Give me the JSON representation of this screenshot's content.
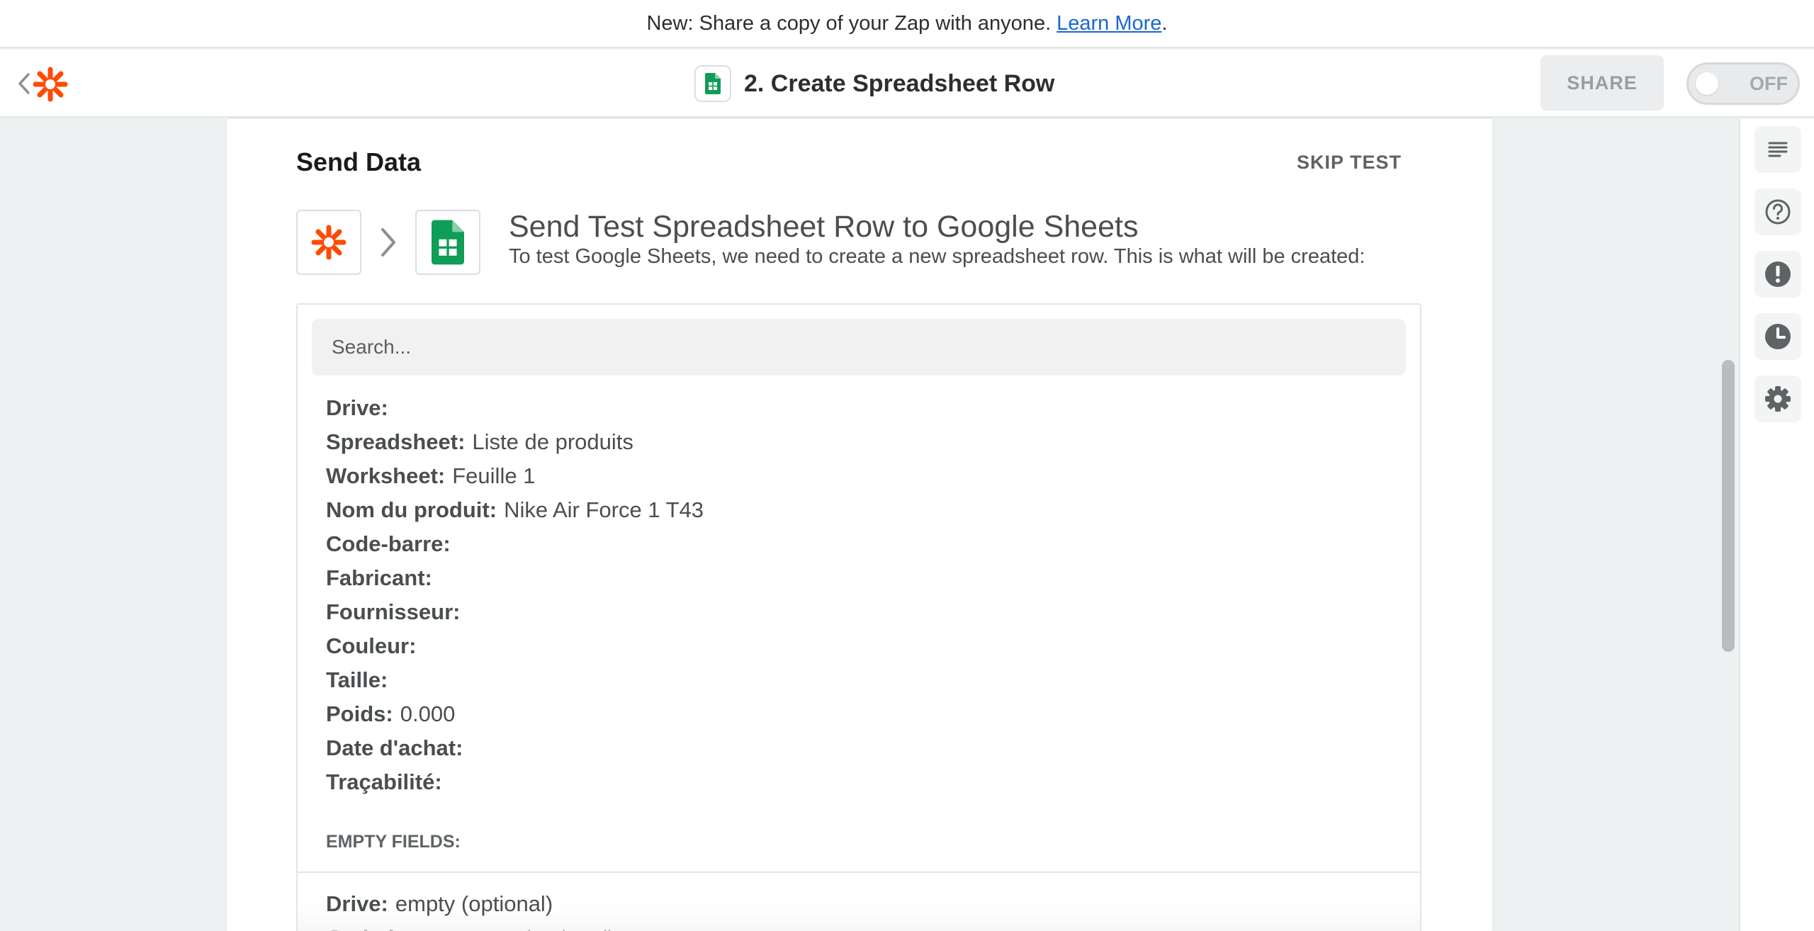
{
  "banner": {
    "text": "New: Share a copy of your Zap with anyone.",
    "link": "Learn More",
    "suffix": "."
  },
  "header": {
    "step_title": "2. Create Spreadsheet Row",
    "share_label": "SHARE",
    "toggle_label": "OFF",
    "toggle_on": false
  },
  "card": {
    "title": "Send Data",
    "skip_test_label": "SKIP TEST",
    "test_heading": "Send Test Spreadsheet Row to Google Sheets",
    "test_sub": "To test Google Sheets, we need to create a new spreadsheet row. This is what will be created:"
  },
  "search": {
    "placeholder": "Search..."
  },
  "fields": [
    {
      "label": "Drive:",
      "value": ""
    },
    {
      "label": "Spreadsheet:",
      "value": "Liste de produits"
    },
    {
      "label": "Worksheet:",
      "value": "Feuille 1"
    },
    {
      "label": "Nom du produit:",
      "value": "Nike Air Force 1 T43"
    },
    {
      "label": "Code-barre:",
      "value": ""
    },
    {
      "label": "Fabricant:",
      "value": ""
    },
    {
      "label": "Fournisseur:",
      "value": ""
    },
    {
      "label": "Couleur:",
      "value": ""
    },
    {
      "label": "Taille:",
      "value": ""
    },
    {
      "label": "Poids:",
      "value": "0.000"
    },
    {
      "label": "Date d'achat:",
      "value": ""
    },
    {
      "label": "Traçabilité:",
      "value": ""
    }
  ],
  "empty_fields": {
    "heading": "EMPTY FIELDS:",
    "rows": [
      {
        "label": "Drive:",
        "value": "empty (optional)"
      },
      {
        "label": "Code-barre:",
        "value": "empty (optional)"
      }
    ]
  },
  "right_rail": [
    "outline-icon",
    "help-icon",
    "alert-icon",
    "history-icon",
    "settings-icon"
  ],
  "colors": {
    "zapier_orange": "#ff4a00",
    "sheets_green": "#0f9d58",
    "link_blue": "#1967d2"
  }
}
